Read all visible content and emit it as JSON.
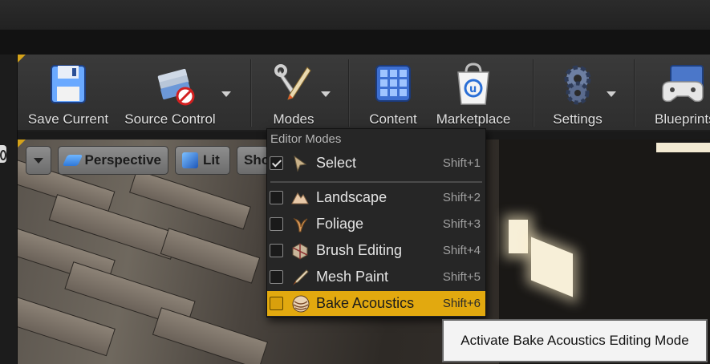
{
  "toolbar": {
    "buttons": [
      {
        "label": "Save Current",
        "icon": "floppy-disk-icon"
      },
      {
        "label": "Source Control",
        "icon": "source-control-icon",
        "has_dropdown": true
      },
      {
        "label": "Modes",
        "icon": "modes-tools-icon",
        "has_dropdown": true
      },
      {
        "label": "Content",
        "icon": "content-grid-icon"
      },
      {
        "label": "Marketplace",
        "icon": "marketplace-bag-icon"
      },
      {
        "label": "Settings",
        "icon": "settings-gear-icon",
        "has_dropdown": true
      },
      {
        "label": "Blueprints",
        "icon": "blueprints-gamepad-icon"
      }
    ]
  },
  "viewport": {
    "options_menu": "viewport-options-caret",
    "perspective_label": "Perspective",
    "lit_label": "Lit",
    "show_label": "Show"
  },
  "modes_menu": {
    "header": "Editor Modes",
    "items": [
      {
        "label": "Select",
        "shortcut": "Shift+1",
        "checked": true,
        "highlighted": false,
        "icon": "select-cursor-icon"
      },
      {
        "label": "Landscape",
        "shortcut": "Shift+2",
        "checked": false,
        "highlighted": false,
        "icon": "landscape-mountain-icon"
      },
      {
        "label": "Foliage",
        "shortcut": "Shift+3",
        "checked": false,
        "highlighted": false,
        "icon": "foliage-leaf-icon"
      },
      {
        "label": "Brush Editing",
        "shortcut": "Shift+4",
        "checked": false,
        "highlighted": false,
        "icon": "brush-editing-cube-icon"
      },
      {
        "label": "Mesh Paint",
        "shortcut": "Shift+5",
        "checked": false,
        "highlighted": false,
        "icon": "mesh-paint-brush-icon"
      },
      {
        "label": "Bake Acoustics",
        "shortcut": "Shift+6",
        "checked": false,
        "highlighted": true,
        "icon": "bake-acoustics-sphere-icon"
      }
    ]
  },
  "tooltip": {
    "text": "Activate Bake Acoustics Editing Mode"
  },
  "colors": {
    "accent": "#e2a90f",
    "menu_bg": "#262626",
    "toolbar_bg": "#353535"
  }
}
